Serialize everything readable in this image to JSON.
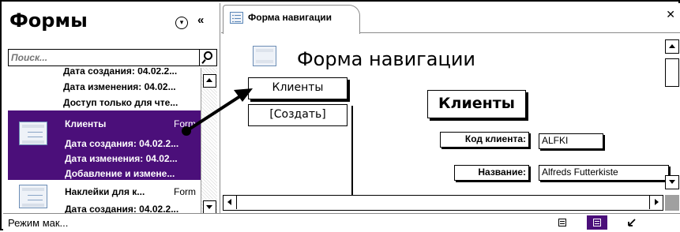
{
  "nav": {
    "title": "Формы",
    "search_placeholder": "Поиск...",
    "prev_item_lines": [
      "Дата создания: 04.02.2...",
      "Дата изменения: 04.02...",
      "Доступ только для чте..."
    ],
    "items": [
      {
        "name": "Клиенты",
        "type": "Form",
        "meta": [
          "Дата создания: 04.02.2...",
          "Дата изменения: 04.02...",
          "Добавление и измене..."
        ]
      },
      {
        "name": "Наклейки для к...",
        "type": "Form",
        "meta": [
          "Дата создания: 04.02.2..."
        ]
      }
    ]
  },
  "doc": {
    "tab_label": "Форма навигации",
    "header_title": "Форма навигации",
    "nav_buttons": [
      "Клиенты",
      "[Создать]"
    ],
    "form_title": "Клиенты",
    "fields": [
      {
        "label": "Код клиента:",
        "value": "ALFKI"
      },
      {
        "label": "Название:",
        "value": "Alfreds Futterkiste"
      }
    ]
  },
  "status": {
    "text": "Режим мак..."
  },
  "colors": {
    "selection": "#4b0f7a"
  }
}
